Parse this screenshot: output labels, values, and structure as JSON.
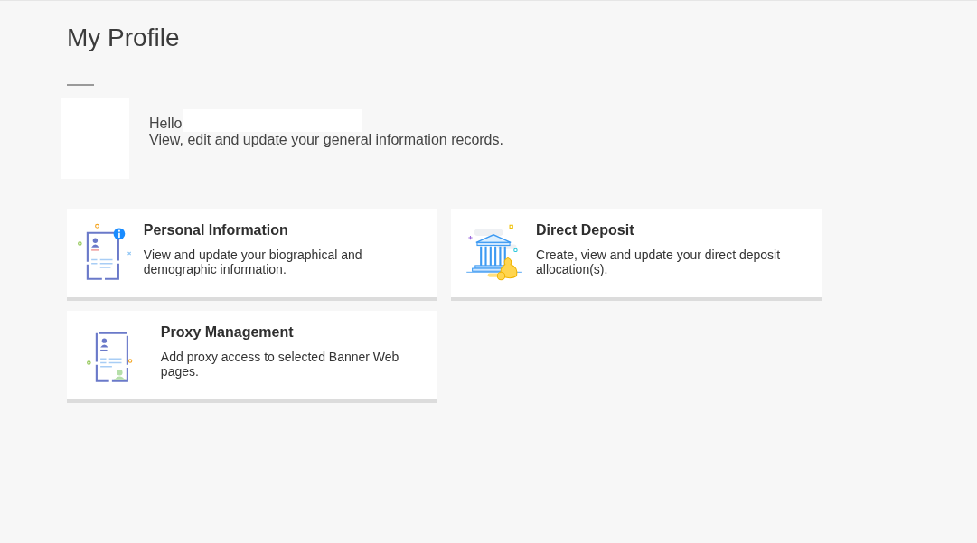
{
  "page": {
    "title": "My Profile"
  },
  "greeting": {
    "hello": "Hello",
    "subtitle": "View, edit and update your general information records."
  },
  "cards": [
    {
      "kind": "profile",
      "title": "Personal Information",
      "description": "View and update your biographical and demographic information."
    },
    {
      "kind": "bank",
      "title": "Direct Deposit",
      "description": "Create, view and update your direct deposit allocation(s)."
    },
    {
      "kind": "proxy",
      "title": "Proxy Management",
      "description": "Add proxy access to selected Banner Web pages."
    }
  ]
}
